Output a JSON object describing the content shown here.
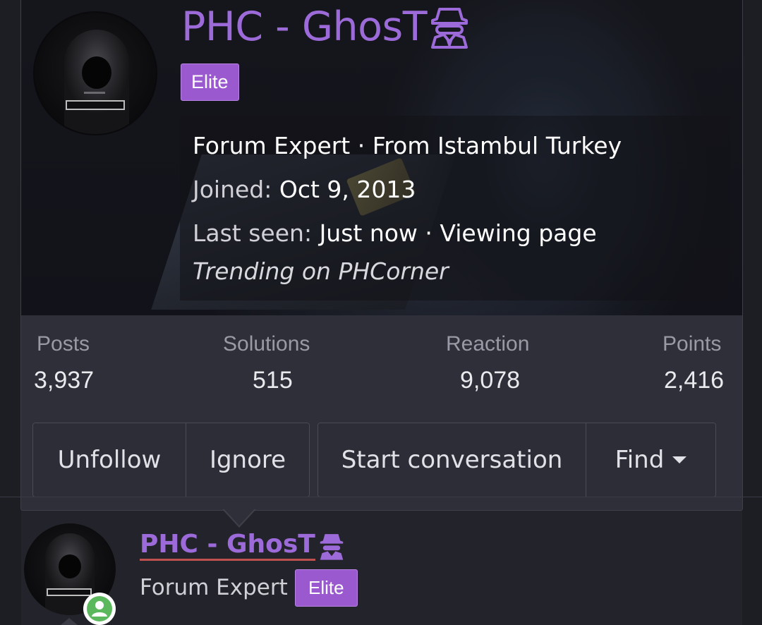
{
  "profile": {
    "username": "PHC - GhosT",
    "username_icon": "user-secret-icon",
    "badge": "Elite",
    "title_line": "Forum Expert · From Istambul Turkey",
    "joined_label": "Joined:",
    "joined_value": "Oct 9, 2013",
    "last_seen_label": "Last seen:",
    "last_seen_value": "Just now · Viewing page",
    "activity": "Trending on PHCorner"
  },
  "stats": [
    {
      "label": "Posts",
      "value": "3,937"
    },
    {
      "label": "Solutions",
      "value": "515"
    },
    {
      "label": "Reaction",
      "value": "9,078"
    },
    {
      "label": "Points",
      "value": "2,416"
    }
  ],
  "actions": {
    "unfollow": "Unfollow",
    "ignore": "Ignore",
    "start_conversation": "Start conversation",
    "find": "Find"
  },
  "post_author": {
    "username": "PHC - GhosT",
    "role": "Forum Expert",
    "badge": "Elite",
    "status": "online"
  },
  "colors": {
    "username": "#9d6bd9",
    "badge_bg": "#9b59d0",
    "online": "#5cb85c",
    "card_bg": "#2e2f38",
    "page_bg": "#23242b"
  }
}
